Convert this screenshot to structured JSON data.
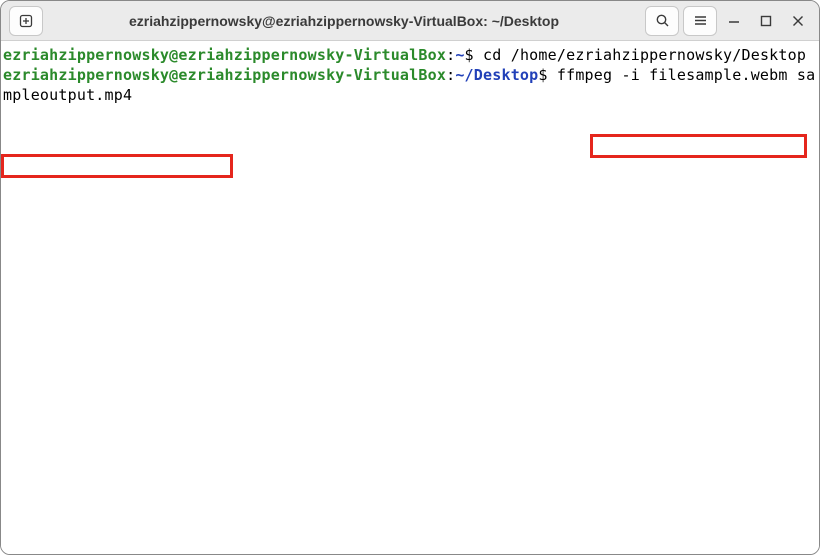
{
  "titlebar": {
    "new_tab_icon": "⊕",
    "title": "ezriahzippernowsky@ezriahzippernowsky-VirtualBox: ~/Desktop",
    "search_icon": "Q",
    "menu_icon": "≡",
    "min_icon": "—",
    "max_icon": "□",
    "close_icon": "×"
  },
  "terminal": {
    "line1": {
      "userhost": "ezriahzippernowsky@ezriahzippernowsky-VirtualBox",
      "colon": ":",
      "path": "~",
      "dollar": "$ ",
      "cmd": "cd /home/ezriahzippernowsky/Desktop"
    },
    "line2": {
      "userhost": "ezriahzippernowsky@ezriahzippernowsky-VirtualBox",
      "colon": ":",
      "path": "~/Desktop",
      "dollar": "$ ",
      "cmd": "ffmpeg -i filesample.webm sampleoutput.mp4"
    }
  }
}
